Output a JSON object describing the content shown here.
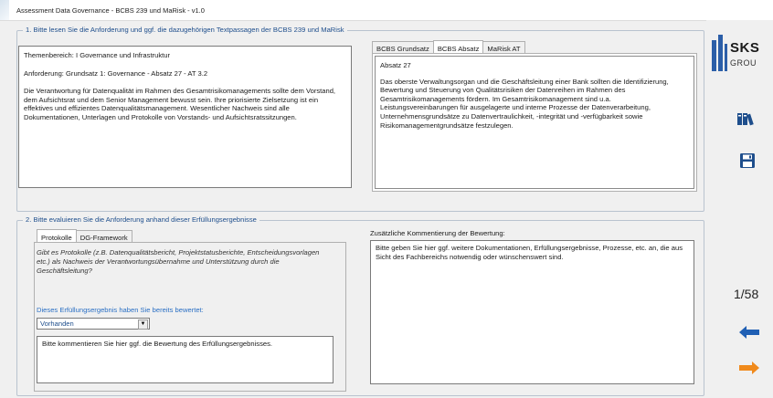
{
  "window": {
    "title": "Assessment Data Governance - BCBS 239 und MaRisk - v1.0"
  },
  "section1": {
    "legend": "1. Bitte lesen Sie die Anforderung und ggf. die dazugehörigen Textpassagen der BCBS 239 und MaRisk",
    "requirement": {
      "topic": "Themenbereich: I Governance und Infrastruktur",
      "requirement_line": "Anforderung: Grundsatz 1: Governance - Absatz 27 - AT 3.2",
      "description": "Die Verantwortung für Datenqualität im Rahmen des Gesamtrisikomanagements sollte dem Vorstand, dem Aufsichtsrat und dem Senior Management bewusst sein. Ihre priorisierte Zielsetzung ist ein effektives und effizientes Datenqualitätsmanagement. Wesentlicher Nachweis sind alle Dokumentationen, Unterlagen und Protokolle von Vorstands- und Aufsichtsratssitzungen."
    },
    "tabs": [
      "BCBS Grundsatz",
      "BCBS Absatz",
      "MaRisk AT"
    ],
    "active_tab_index": 1,
    "passage": {
      "heading": "Absatz 27",
      "text": "Das oberste Verwaltungsorgan und die Geschäftsleitung einer Bank sollten die Identifizierung, Bewertung und Steuerung von Qualitätsrisiken der Datenreihen im Rahmen des Gesamtrisikomanagements fördern. Im Gesamtrisikomanagement sind u.a. Leistungsvereinbarungen für ausgelagerte und interne Prozesse der Datenverarbeitung, Unternehmensgrundsätze zu Datenvertraulichkeit, -integrität und -verfügbarkeit sowie Risikomanagementgrundsätze festzulegen."
    }
  },
  "section2": {
    "legend": "2. Bitte evaluieren Sie die Anforderung anhand dieser Erfüllungsergebnisse",
    "tabs": [
      "Protokolle",
      "DG-Framework"
    ],
    "active_tab_index": 0,
    "question": "Gibt es Protokolle (z.B. Datenqualitätsbericht, Projektstatusberichte, Entscheidungsvorlagen etc.) als Nachweis der Verantwortungsübernahme und Unterstützung durch die Geschäftsleitung?",
    "rating_label": "Dieses Erfüllungsergebnis haben Sie bereits bewertet:",
    "rating_value": "Vorhanden",
    "comment_text": "Bitte kommentieren Sie hier ggf. die Bewertung des Erfüllungsergebnisses.",
    "additional_label": "Zusätzliche Kommentierung der Bewertung:",
    "additional_text": "Bitte geben Sie hier ggf. weitere Dokumentationen, Erfüllungsergebnisse, Prozesse, etc. an, die aus Sicht des Fachbereichs notwendig oder wünschenswert sind."
  },
  "sidebar": {
    "logo_text": "SKS",
    "logo_sub": "GROU",
    "page_counter": "1/58",
    "icons": {
      "library": "library-icon",
      "save": "save-icon",
      "back": "arrow-left-icon",
      "forward": "arrow-right-icon"
    },
    "colors": {
      "logo_blue": "#2b5ea8",
      "nav_blue": "#1f5fb4",
      "nav_orange": "#f08a1c"
    }
  }
}
